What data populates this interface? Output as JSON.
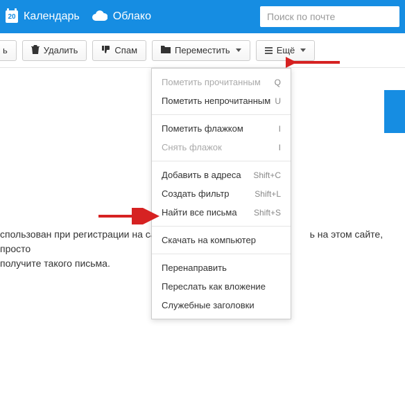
{
  "topbar": {
    "calendar_label": "Календарь",
    "calendar_day": "20",
    "cloud_label": "Облако",
    "search_placeholder": "Поиск по почте"
  },
  "toolbar": {
    "reply_suffix": "ь",
    "delete_label": "Удалить",
    "spam_label": "Спам",
    "move_label": "Переместить",
    "more_label": "Ещё"
  },
  "dropdown": {
    "mark_read": "Пометить прочитанным",
    "mark_read_key": "Q",
    "mark_unread": "Пометить непрочитанным",
    "mark_unread_key": "U",
    "flag": "Пометить флажком",
    "flag_key": "I",
    "unflag": "Снять флажок",
    "unflag_key": "I",
    "add_address": "Добавить в адреса",
    "add_address_key": "Shift+C",
    "create_filter": "Создать фильтр",
    "create_filter_key": "Shift+L",
    "find_all": "Найти все письма",
    "find_all_key": "Shift+S",
    "download": "Скачать на компьютер",
    "redirect": "Перенаправить",
    "forward_attach": "Переслать как вложение",
    "headers": "Служебные заголовки"
  },
  "body": {
    "text_left": "спользован при регистрации на сайт",
    "text_right": "ь на этом сайте, просто",
    "text_line2": "получите такого письма."
  },
  "colors": {
    "brand": "#168de2",
    "arrow": "#d62222"
  }
}
